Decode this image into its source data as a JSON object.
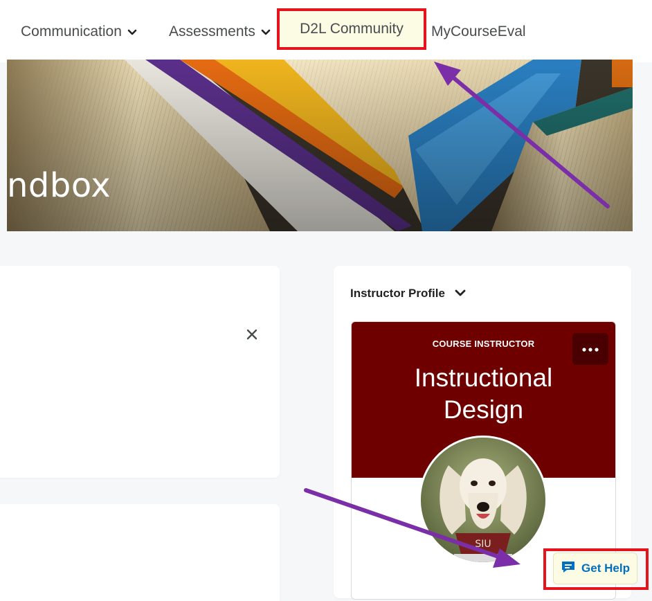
{
  "nav": {
    "items": [
      {
        "label": "Communication"
      },
      {
        "label": "Assessments"
      },
      {
        "label": "D2L Community"
      },
      {
        "label": "MyCourseEval"
      }
    ]
  },
  "banner": {
    "title": "ndbox"
  },
  "widget": {
    "title": "Instructor Profile"
  },
  "profile": {
    "role_label": "COURSE INSTRUCTOR",
    "name_line1": "Instructional",
    "name_line2": "Design",
    "avatar_text": "SIU"
  },
  "help": {
    "label": "Get Help"
  },
  "icons": {
    "close": "close-icon",
    "more": "more-icon",
    "chevron": "chevron-down-icon",
    "chat": "chat-icon"
  },
  "colors": {
    "highlight_border": "#e5141c",
    "highlight_fill": "#fcfbe3",
    "profile_bg": "#6e0000",
    "arrow": "#7a2fa8",
    "help_text": "#006fbf"
  }
}
